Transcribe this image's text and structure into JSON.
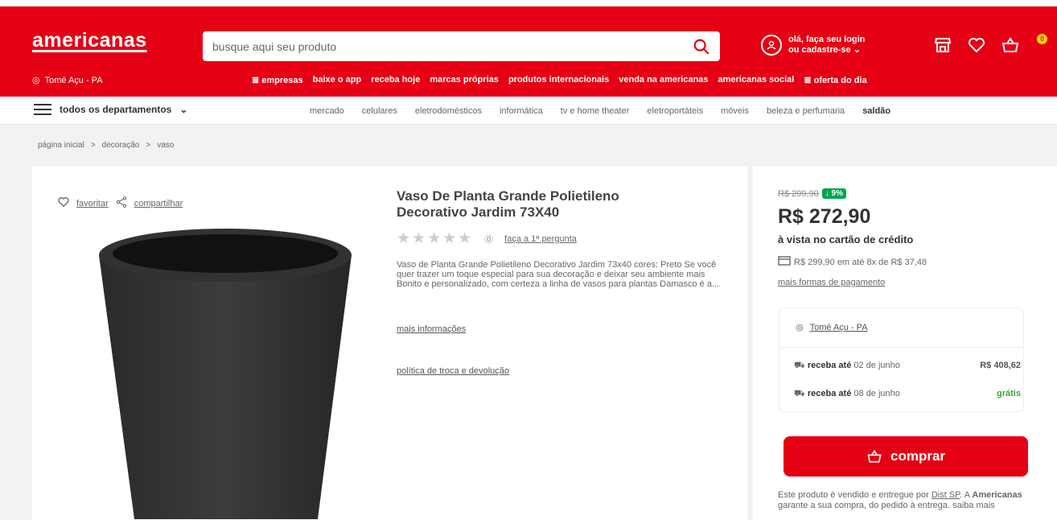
{
  "header": {
    "logo": "americanas",
    "search_placeholder": "busque aqui seu produto",
    "login_line1": "olá, faça seu login",
    "login_line2": "ou cadastre-se",
    "cart_count": "0",
    "location": "Tomé Açu - PA",
    "quick_links": [
      "≣ empresas",
      "baixe o app",
      "receba hoje",
      "marcas próprias",
      "produtos internacionais",
      "venda na americanas",
      "americanas social",
      "≣ oferta do dia"
    ]
  },
  "nav": {
    "all_departments": "todos os departamentos",
    "links": [
      "mercado",
      "celulares",
      "eletrodomésticos",
      "informática",
      "tv e home theater",
      "eletroportáteis",
      "móveis",
      "beleza e perfumaria",
      "saldão"
    ]
  },
  "breadcrumb": [
    "página inicial",
    ">",
    "decoração",
    ">",
    "vaso"
  ],
  "product": {
    "favorite_label": "favoritar",
    "share_label": "compartilhar",
    "title": "Vaso De Planta Grande Polietileno Decorativo Jardim 73X40",
    "stars": "★★★★★",
    "question_link": "faça a 1ª pergunta",
    "description": "Vaso de Planta Grande Polietileno Decorativo Jardim 73x40 cores: Preto Se você quer trazer um toque especial para sua decoração e deixar seu ambiente mais Bonito e personalizado, com certeza a linha de vasos para plantas Damasco é a...",
    "more_info": "mais informações",
    "policy": "política de troca e devolução"
  },
  "buybox": {
    "old_price": "R$ 299,90",
    "discount": "↓ 9%",
    "price": "R$ 272,90",
    "price_note": "à vista no cartão de crédito",
    "installments": "R$ 299,90 em até 8x de R$ 37,48",
    "more_payments": "mais formas de pagamento",
    "ship_location": "Tomé Açu - PA",
    "shipping": [
      {
        "label_bold": "receba até",
        "label_rest": " 02 de junho",
        "value": "R$ 408,62",
        "free": false
      },
      {
        "label_bold": "receba até",
        "label_rest": " 08 de junho",
        "value": "grátis",
        "free": true
      }
    ],
    "buy_label": "comprar",
    "seller_text1": "Este produto é vendido e entregue por ",
    "seller_name": "Dist SP",
    "seller_text2": ". A ",
    "seller_brand": "Americanas",
    "seller_text3": " garante a sua compra, do pedido à entrega. saiba mais"
  },
  "colors": {
    "brand_red": "#e60014",
    "discount_green": "#00a650",
    "free_green": "#3aa537"
  }
}
